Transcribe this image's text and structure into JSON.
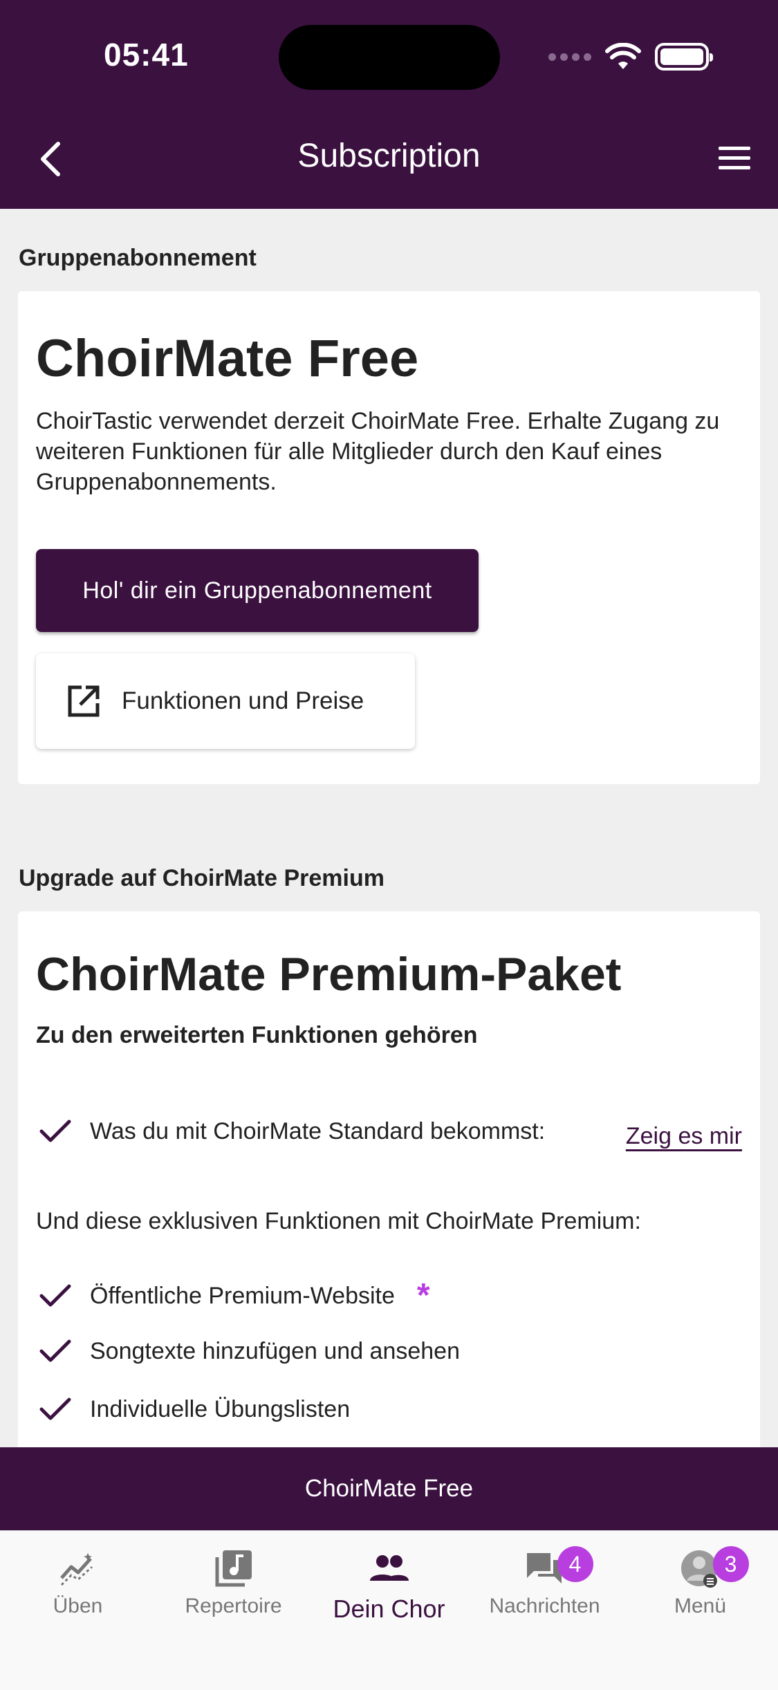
{
  "status_bar": {
    "time": "05:41"
  },
  "nav": {
    "title": "Subscription"
  },
  "group_section": {
    "label": "Gruppenabonnement",
    "card_title": "ChoirMate Free",
    "description": "ChoirTastic verwendet derzeit ChoirMate Free. Erhalte Zugang zu weiteren Funktionen für alle Mitglieder durch den Kauf eines Gruppenabonnements.",
    "primary_button": "Hol' dir ein Gruppenabonnement",
    "secondary_button": "Funktionen und Preise"
  },
  "premium_section": {
    "label": "Upgrade auf ChoirMate Premium",
    "card_title": "ChoirMate Premium-Paket",
    "subtitle": "Zu den erweiterten Funktionen gehören",
    "standard_row": "Was du mit ChoirMate Standard bekommst:",
    "show_link": "Zeig es mir",
    "exclusive_intro": "Und diese exklusiven Funktionen mit ChoirMate Premium:",
    "features": [
      "Öffentliche Premium-Website",
      "Songtexte hinzufügen und ansehen",
      "Individuelle Übungslisten"
    ],
    "asterisk": "*"
  },
  "plan_bar": {
    "label": "ChoirMate Free"
  },
  "tabs": [
    {
      "label": "Üben",
      "icon": "chart-line-icon"
    },
    {
      "label": "Repertoire",
      "icon": "music-note-icon"
    },
    {
      "label": "Dein Chor",
      "icon": "group-icon"
    },
    {
      "label": "Nachrichten",
      "icon": "chat-icon",
      "badge": "4"
    },
    {
      "label": "Menü",
      "icon": "avatar-icon",
      "badge": "3"
    }
  ],
  "colors": {
    "brand": "#3b1140",
    "accent": "#b83ee0",
    "background": "#efefef"
  }
}
